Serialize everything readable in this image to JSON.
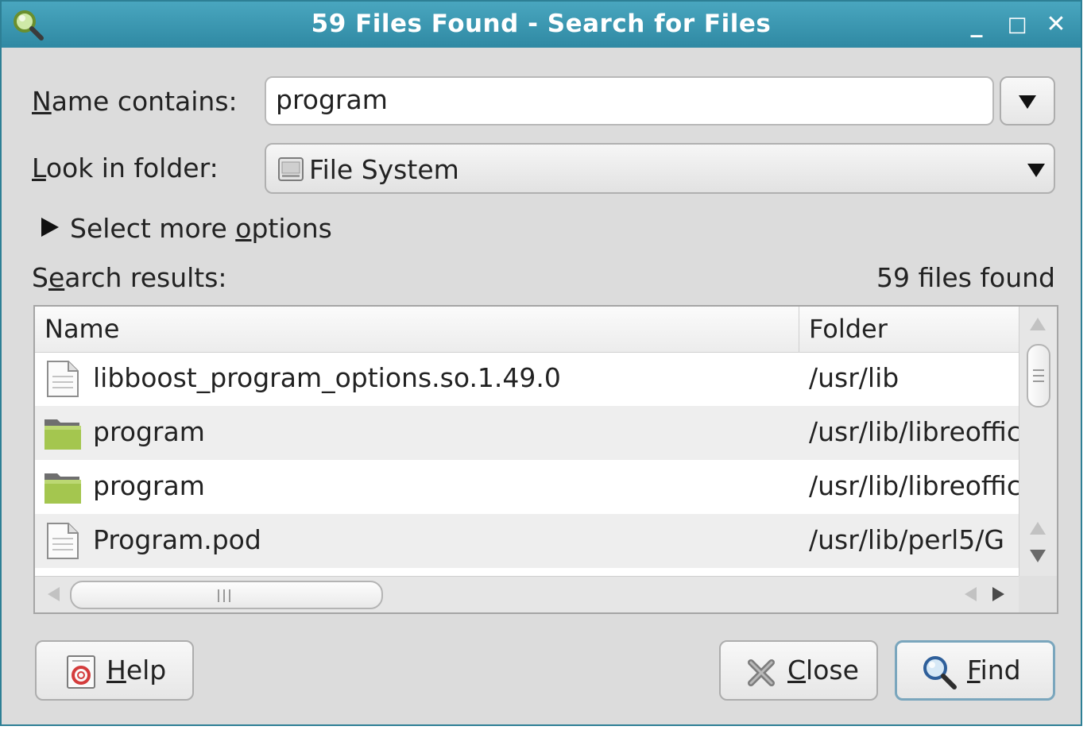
{
  "window": {
    "title": "59 Files Found - Search for Files",
    "controls": {
      "minimize": "_",
      "maximize": "□",
      "close": "✕"
    }
  },
  "form": {
    "name_contains_label_mnemonic": "N",
    "name_contains_label_rest": "ame contains:",
    "name_value": "program",
    "look_in_label_mnemonic": "L",
    "look_in_label_rest": "ook in folder:",
    "folder_value": "File System",
    "more_options_pre": "Select more ",
    "more_options_mnemonic": "o",
    "more_options_post": "ptions"
  },
  "results": {
    "label_pre": "S",
    "label_mnemonic": "e",
    "label_post": "arch results:",
    "count_text": "59 files found",
    "columns": {
      "name": "Name",
      "folder": "Folder"
    },
    "rows": [
      {
        "name": "libboost_program_options.so.1.49.0",
        "folder": "/usr/lib",
        "icon": "document-icon"
      },
      {
        "name": "program",
        "folder": "/usr/lib/libreoffice",
        "icon": "folder-icon"
      },
      {
        "name": "program",
        "folder": "/usr/lib/libreoffice",
        "icon": "folder-icon"
      },
      {
        "name": "Program.pod",
        "folder": "/usr/lib/perl5/G",
        "icon": "document-icon"
      }
    ]
  },
  "buttons": {
    "help_mnemonic": "H",
    "help_rest": "elp",
    "close_mnemonic": "C",
    "close_rest": "lose",
    "find_mnemonic": "F",
    "find_rest": "ind"
  },
  "colors": {
    "titlebar": "#3a96b0",
    "dialog_bg": "#dcdcdc",
    "folder_green": "#a4c64f"
  }
}
